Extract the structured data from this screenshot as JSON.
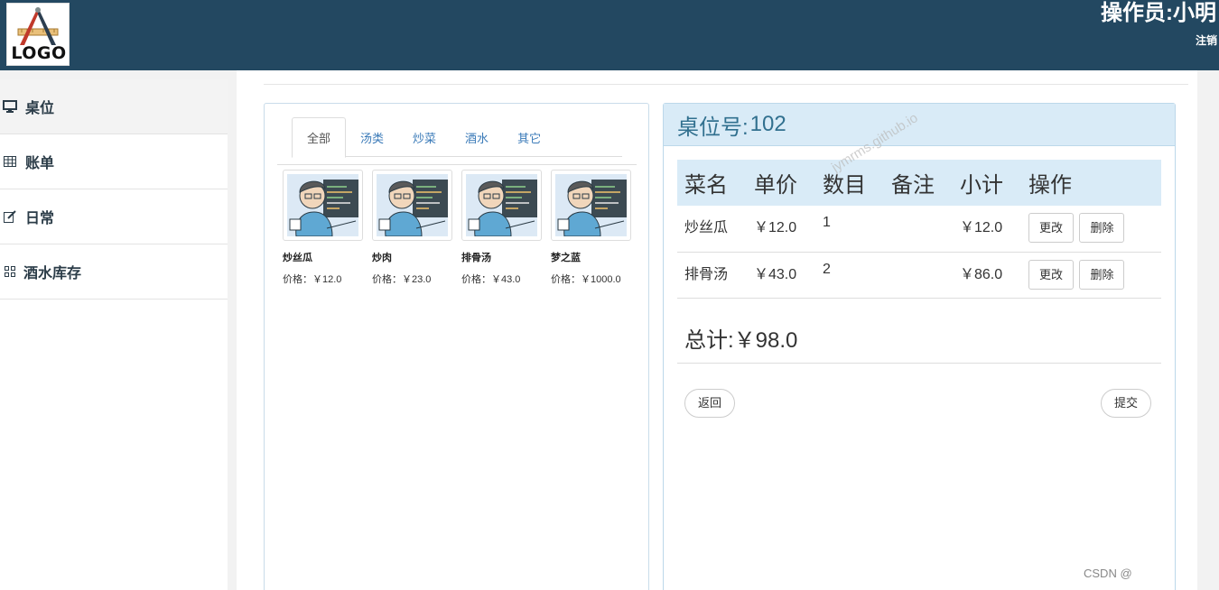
{
  "header": {
    "logo_text": "LOGO",
    "operator": "操作员:小明",
    "logout": "注销"
  },
  "sidebar": {
    "items": [
      {
        "label": "桌位",
        "icon": "monitor-icon"
      },
      {
        "label": "账单",
        "icon": "table-icon"
      },
      {
        "label": "日常",
        "icon": "edit-icon"
      },
      {
        "label": "酒水库存",
        "icon": "grid-icon"
      }
    ]
  },
  "menu": {
    "tabs": [
      "全部",
      "汤类",
      "炒菜",
      "酒水",
      "其它"
    ],
    "active_tab": "全部",
    "dishes": [
      {
        "name": "炒丝瓜",
        "price": "价格：￥12.0"
      },
      {
        "name": "炒肉",
        "price": "价格：￥23.0"
      },
      {
        "name": "排骨汤",
        "price": "价格：￥43.0"
      },
      {
        "name": "梦之蓝",
        "price": "价格：￥1000.0"
      }
    ]
  },
  "order": {
    "table_label": "桌位号:",
    "table_number": "102",
    "columns": [
      "菜名",
      "单价",
      "数目",
      "备注",
      "小计",
      "操作"
    ],
    "rows": [
      {
        "name": "炒丝瓜",
        "price": "￥12.0",
        "qty": "1",
        "note": "",
        "subtotal": "￥12.0",
        "edit": "更改",
        "delete": "删除"
      },
      {
        "name": "排骨汤",
        "price": "￥43.0",
        "qty": "2",
        "note": "",
        "subtotal": "￥86.0",
        "edit": "更改",
        "delete": "删除"
      }
    ],
    "total": "总计:￥98.0",
    "back": "返回",
    "submit": "提交"
  },
  "watermark": "jymrms.github.io",
  "csdn": "CSDN @"
}
